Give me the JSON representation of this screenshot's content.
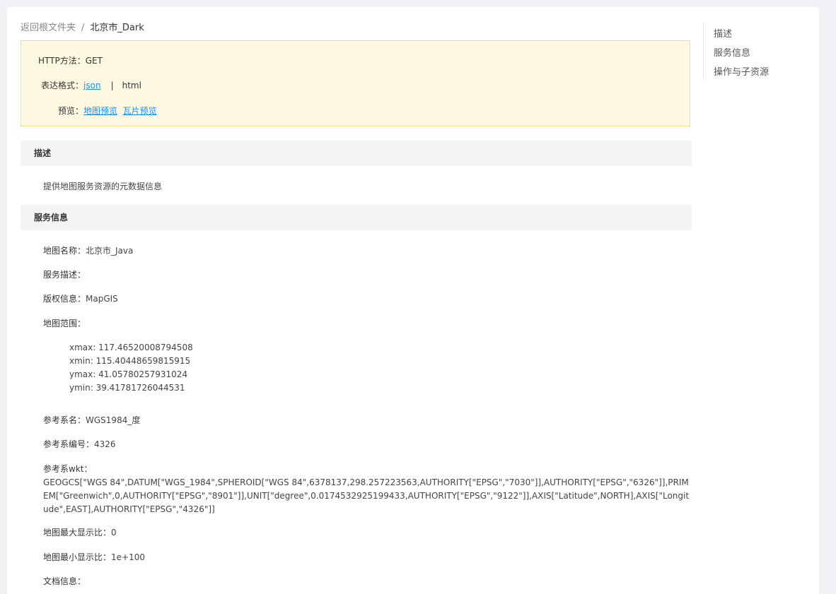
{
  "breadcrumb": {
    "root": "返回根文件夹",
    "separator": "/",
    "current": "北京市_Dark"
  },
  "info": {
    "http_method_label": "HTTP方法：",
    "http_method_value": "GET",
    "format_label": "表达格式：",
    "format_json": "json",
    "format_sep": "|",
    "format_html": "html",
    "preview_label": "预览：",
    "preview_map": "地图预览",
    "preview_tile": "瓦片预览"
  },
  "sections": {
    "description": {
      "title": "描述",
      "text": "提供地图服务资源的元数据信息"
    },
    "service_info": {
      "title": "服务信息"
    }
  },
  "service": {
    "map_name_label": "地图名称：",
    "map_name": "北京市_Java",
    "service_desc_label": "服务描述：",
    "copyright_label": "版权信息：",
    "copyright": "MapGIS",
    "extent_label": "地图范围：",
    "extent": {
      "xmax": "xmax: 117.46520008794508",
      "xmin": "xmin: 115.40448659815915",
      "ymax": "ymax: 41.05780257931024",
      "ymin": "ymin: 39.41781726044531"
    },
    "srs_name_label": "参考系名：",
    "srs_name": "WGS1984_度",
    "srs_code_label": "参考系编号：",
    "srs_code": "4326",
    "wkt_label": "参考系wkt：",
    "wkt": "GEOGCS[\"WGS 84\",DATUM[\"WGS_1984\",SPHEROID[\"WGS 84\",6378137,298.257223563,AUTHORITY[\"EPSG\",\"7030\"]],AUTHORITY[\"EPSG\",\"6326\"]],PRIMEM[\"Greenwich\",0,AUTHORITY[\"EPSG\",\"8901\"]],UNIT[\"degree\",0.0174532925199433,AUTHORITY[\"EPSG\",\"9122\"]],AXIS[\"Latitude\",NORTH],AXIS[\"Longitude\",EAST],AUTHORITY[\"EPSG\",\"4326\"]]",
    "max_scale_label": "地图最大显示比：",
    "max_scale": "0",
    "min_scale_label": "地图最小显示比：",
    "min_scale": "1e+100",
    "doc_info_label": "文档信息："
  },
  "toc": {
    "items": [
      "描述",
      "服务信息",
      "操作与子资源"
    ]
  }
}
